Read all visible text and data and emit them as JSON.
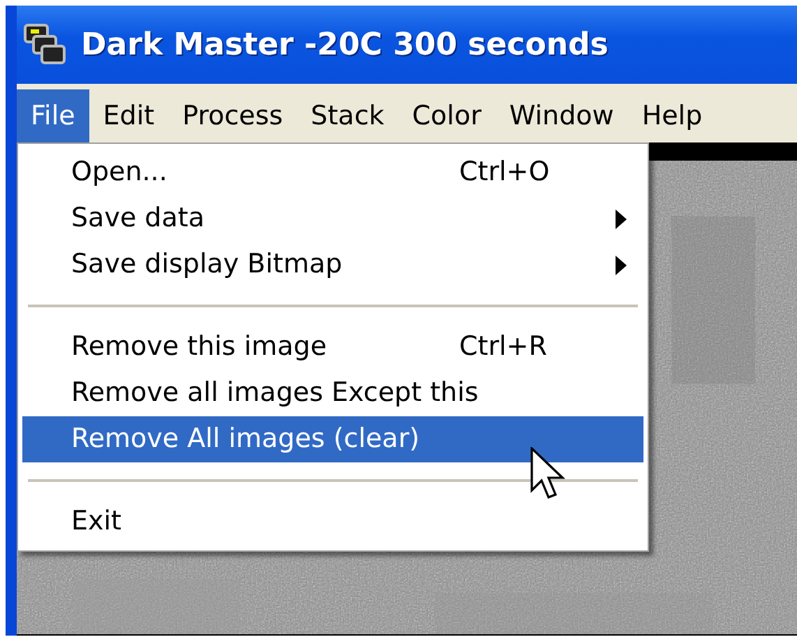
{
  "window": {
    "title": "Dark Master -20C 300 seconds"
  },
  "menu_bar": [
    {
      "label": "File",
      "selected": true
    },
    {
      "label": "Edit",
      "selected": false
    },
    {
      "label": "Process",
      "selected": false
    },
    {
      "label": "Stack",
      "selected": false
    },
    {
      "label": "Color",
      "selected": false
    },
    {
      "label": "Window",
      "selected": false
    },
    {
      "label": "Help",
      "selected": false
    }
  ],
  "file_menu": [
    {
      "kind": "item",
      "label": "Open...",
      "shortcut": "Ctrl+O",
      "submenu": false,
      "selected": false
    },
    {
      "kind": "item",
      "label": "Save data",
      "submenu": true,
      "selected": false
    },
    {
      "kind": "item",
      "label": "Save display Bitmap",
      "submenu": true,
      "selected": false
    },
    {
      "kind": "separator"
    },
    {
      "kind": "item",
      "label": "Remove this image",
      "shortcut": "Ctrl+R",
      "submenu": false,
      "selected": false
    },
    {
      "kind": "item",
      "label": "Remove all images Except this",
      "submenu": false,
      "selected": false
    },
    {
      "kind": "item",
      "label": "Remove All images (clear)",
      "submenu": false,
      "selected": true
    },
    {
      "kind": "separator"
    },
    {
      "kind": "item",
      "label": "Exit",
      "submenu": false,
      "selected": false
    }
  ]
}
